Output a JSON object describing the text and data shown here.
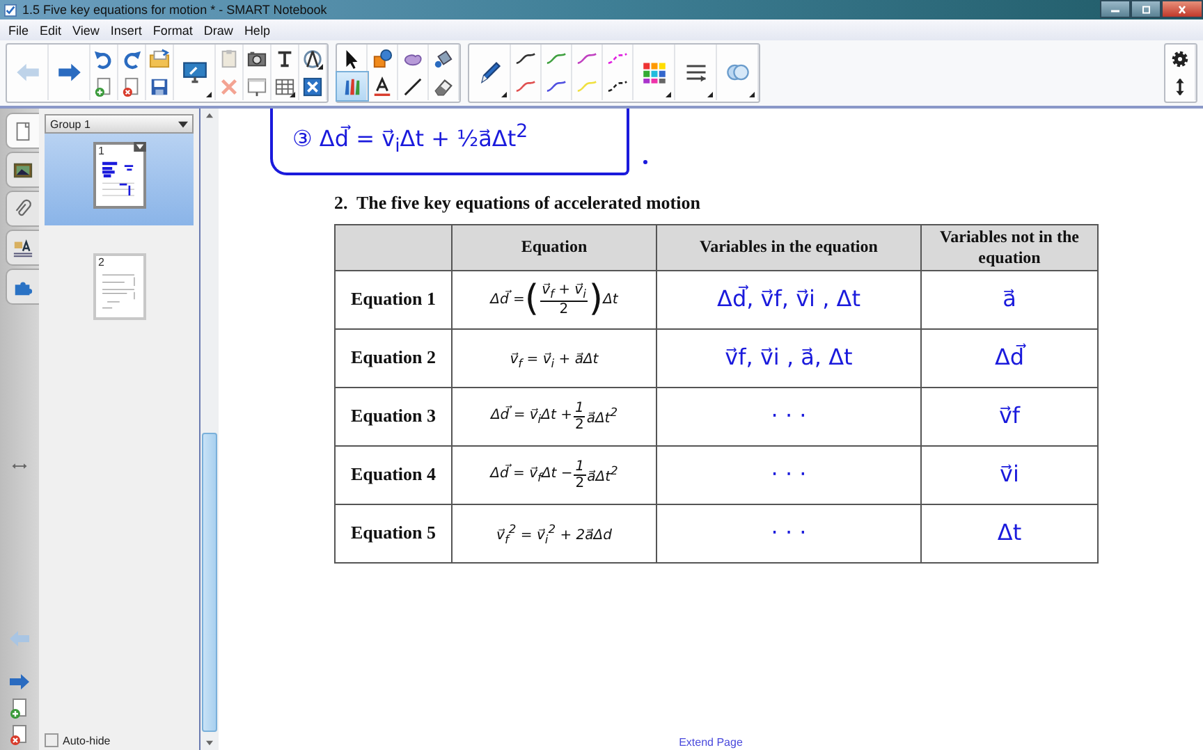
{
  "window": {
    "title": "1.5 Five key equations for motion * - SMART Notebook"
  },
  "menu": [
    "File",
    "Edit",
    "View",
    "Insert",
    "Format",
    "Draw",
    "Help"
  ],
  "tools": [
    {
      "kind": "select",
      "selected": false
    },
    {
      "kind": "shapes",
      "selected": false
    },
    {
      "kind": "creative-pen",
      "selected": false
    },
    {
      "kind": "fill",
      "selected": false
    },
    {
      "kind": "pens",
      "selected": true
    },
    {
      "kind": "text",
      "selected": false
    },
    {
      "kind": "line",
      "selected": false
    },
    {
      "kind": "eraser",
      "selected": false
    }
  ],
  "side_tabs": [
    {
      "kind": "page-sorter",
      "selected": true
    },
    {
      "kind": "gallery",
      "selected": false
    },
    {
      "kind": "attachments",
      "selected": false
    },
    {
      "kind": "properties",
      "selected": false
    },
    {
      "kind": "add-ons",
      "selected": false
    }
  ],
  "page_sorter": {
    "group": "Group 1",
    "pages": [
      {
        "number": "1",
        "selected": true
      },
      {
        "number": "2",
        "selected": false
      }
    ],
    "auto_hide": {
      "label": "Auto-hide",
      "checked": false
    }
  },
  "canvas": {
    "ink_note": "③ Δd⃗ = v⃗$_{i}$Δt + ½a⃗Δt$^{2}$",
    "heading": "2.  The five key equations of accelerated motion",
    "table": {
      "columns": [
        "Equation",
        "Variables in the equation",
        "Variables not in the equation"
      ],
      "rows": [
        {
          "label": "Equation 1",
          "equation": [
            {
              "kind": "text",
              "text": "Δd⃗ = "
            },
            {
              "kind": "big",
              "text": "("
            },
            {
              "kind": "frac",
              "num": "v⃗$_{f}$ + v⃗$_{i}$",
              "den": "2"
            },
            {
              "kind": "big",
              "text": ")"
            },
            {
              "kind": "text",
              "text": "Δt"
            }
          ],
          "variables_in": "Δd⃗, v⃗f, v⃗i , Δt",
          "variables_not_in": "a⃗"
        },
        {
          "label": "Equation 2",
          "equation": [
            {
              "kind": "text",
              "text": "v⃗$_{f}$ = v⃗$_{i}$ + a⃗Δt"
            }
          ],
          "variables_in": "v⃗f, v⃗i , a⃗, Δt",
          "variables_not_in": "Δd⃗"
        },
        {
          "label": "Equation 3",
          "equation": [
            {
              "kind": "text",
              "text": "Δd⃗ = v⃗$_{i}$Δt + "
            },
            {
              "kind": "frac",
              "num": "1",
              "den": "2"
            },
            {
              "kind": "text",
              "text": "a⃗Δt$^{2}$"
            }
          ],
          "variables_in": "· · ·",
          "variables_not_in": "v⃗f"
        },
        {
          "label": "Equation 4",
          "equation": [
            {
              "kind": "text",
              "text": "Δd⃗ = v⃗$_{f}$Δt − "
            },
            {
              "kind": "frac",
              "num": "1",
              "den": "2"
            },
            {
              "kind": "text",
              "text": "a⃗Δt$^{2}$"
            }
          ],
          "variables_in": "· · ·",
          "variables_not_in": "v⃗i"
        },
        {
          "label": "Equation 5",
          "equation": [
            {
              "kind": "text",
              "text": "v⃗$_{f}$$^{2}$ = v⃗$_{i}$$^{2}$ + 2a⃗Δd"
            }
          ],
          "variables_in": "· · ·",
          "variables_not_in": "Δt"
        }
      ]
    },
    "extend_page": "Extend Page"
  }
}
